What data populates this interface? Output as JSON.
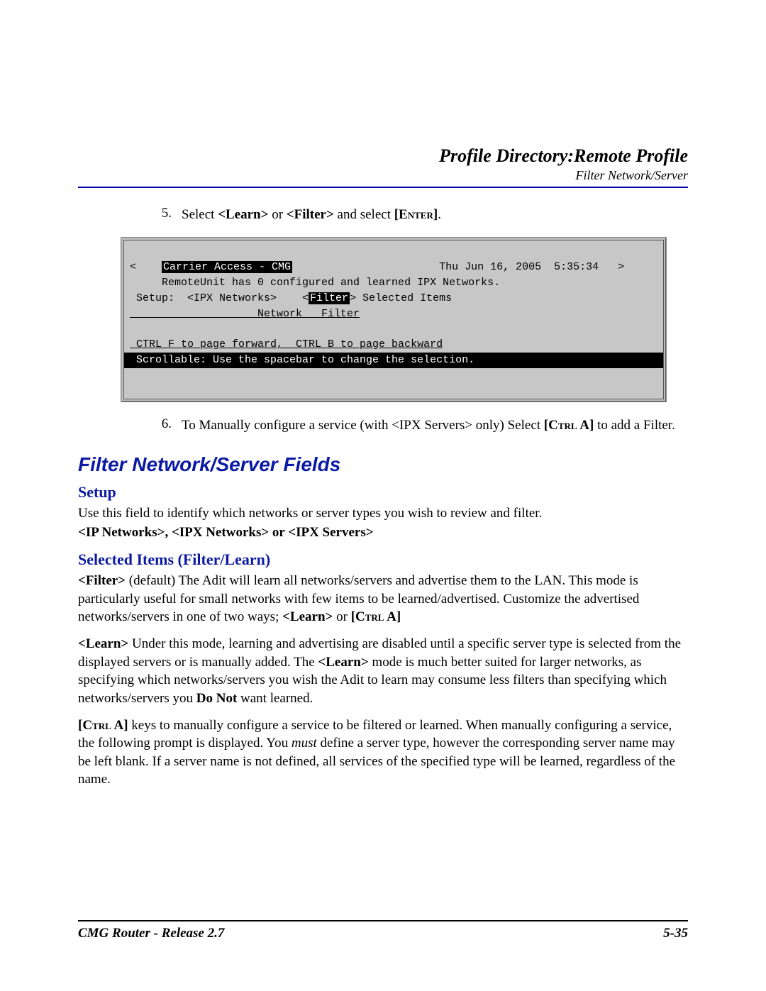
{
  "header": {
    "title": "Profile Directory:Remote Profile",
    "subtitle": "Filter Network/Server"
  },
  "steps": {
    "five": {
      "num": "5.",
      "pre": "Select ",
      "learn": "<Learn>",
      "or": " or ",
      "filter": "<Filter>",
      "post": " and select ",
      "enter": "[Enter]",
      "dot": "."
    },
    "six": {
      "num": "6.",
      "pre": "To Manually configure a service (with <IPX Servers> only)  Select ",
      "ctrl": "[Ctrl A]",
      "post": " to add a Filter."
    }
  },
  "terminal": {
    "l1_left": "<",
    "l1_title": "Carrier Access - CMG",
    "l1_right": "Thu Jun 16, 2005  5:35:34   >",
    "l2": "     RemoteUnit has 0 configured and learned IPX Networks.",
    "l3_pre": " Setup:  <IPX Networks>    <",
    "l3_sel": "Filter",
    "l3_post": "> Selected Items",
    "l4": "                    Network   Filter",
    "l5": " CTRL F to page forward,  CTRL B to page backward",
    "l6": " Scrollable: Use the spacebar to change the selection.                      "
  },
  "section_title": "Filter Network/Server Fields",
  "setup": {
    "heading": "Setup",
    "p1": "Use this field to identify which networks or server types you wish to review and filter.",
    "p2": " <IP Networks>, <IPX Networks> or <IPX Servers>"
  },
  "selected": {
    "heading": "Selected Items (Filter/Learn)",
    "filter_label": "<Filter>",
    "filter_body": "  (default) The Adit will learn all networks/servers and advertise them to the LAN. This mode is particularly useful for small networks with few items to be learned/advertised. Customize the advertised networks/servers in one of two ways; ",
    "learn_inline": "<Learn>",
    "or": " or ",
    "ctrl_a": "[Ctrl A]",
    "learn_label": "<Learn>",
    "learn_body1": " Under this mode, learning and advertising are disabled until a specific server type is selected from the displayed servers or is manually added. The ",
    "learn_body2": " mode is much better suited for larger networks, as specifying which networks/servers you wish the Adit to learn may consume less filters than specifying which networks/servers you ",
    "donot": "Do Not",
    "learn_body3": " want learned.",
    "ctrl_p_pre": "[Ctrl A]",
    "ctrl_p1": " keys to manually configure a service to be filtered or learned. When manually configuring a service, the following prompt is displayed. You ",
    "must": "must",
    "ctrl_p2": " define a server type, however the corresponding server name may be left blank. If a server name is not defined, all services of the specified type will be learned, regardless of the name."
  },
  "footer": {
    "left": "CMG Router - Release 2.7",
    "right": "5-35"
  }
}
